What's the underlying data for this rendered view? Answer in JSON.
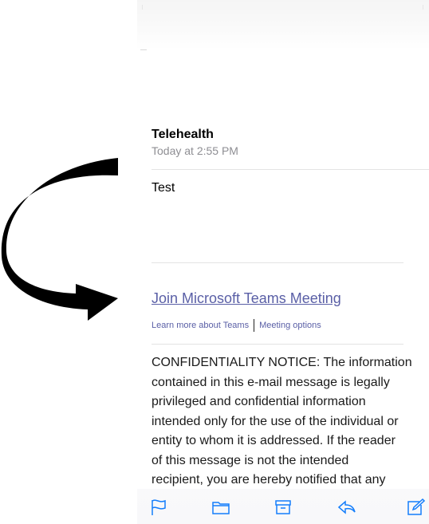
{
  "message": {
    "sender": "Telehealth",
    "timestamp": "Today at 2:55 PM",
    "body": "Test",
    "teams_link": "Join Microsoft Teams Meeting",
    "learn_more": "Learn more about Teams",
    "meeting_options": "Meeting options",
    "confidentiality": "CONFIDENTIALITY NOTICE: The information\ncontained in this e-mail message is legally\nprivileged and confidential information\nintended only for the use of the individual or\nentity to whom it is addressed. If the reader\nof this message is not the intended\nrecipient, you are hereby notified that any\nuse, dissemination, distribution or copy of"
  },
  "toolbar": {
    "icons": [
      "flag-icon",
      "folder-icon",
      "archive-icon",
      "reply-icon",
      "compose-icon"
    ]
  },
  "colors": {
    "accent": "#147efb",
    "link": "#5a5fa6",
    "secondary_text": "#8e8e93",
    "arrow": "#000000"
  }
}
